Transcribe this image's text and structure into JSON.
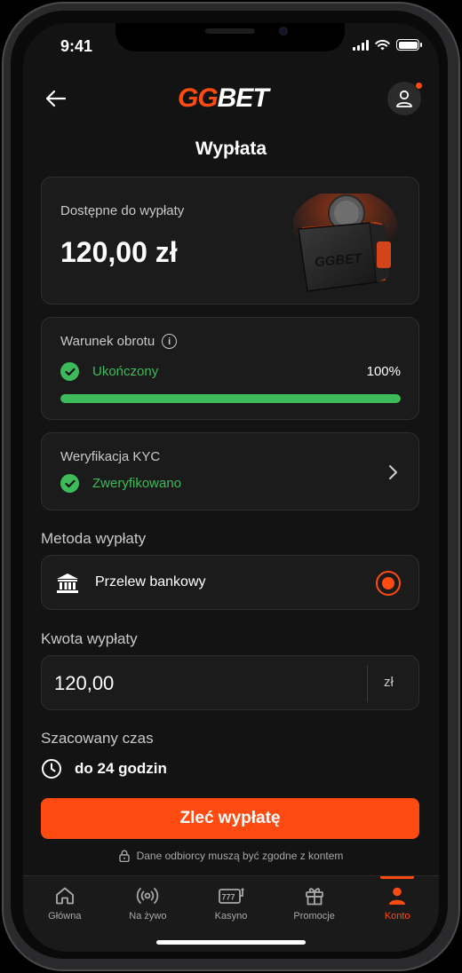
{
  "status_bar": {
    "time": "9:41"
  },
  "header": {
    "logo_gg": "GG",
    "logo_bet": "BET"
  },
  "page": {
    "title": "Wypłata"
  },
  "balance": {
    "label": "Dostępne do wypłaty",
    "value": "120,00 zł"
  },
  "turnover": {
    "label": "Warunek obrotu",
    "status": "Ukończony",
    "percent": "100%",
    "progress": 1.0
  },
  "kyc": {
    "label": "Weryfikacja KYC",
    "status": "Zweryfikowano"
  },
  "method": {
    "section_label": "Metoda wypłaty",
    "name": "Przelew bankowy",
    "selected": true
  },
  "amount": {
    "section_label": "Kwota wypłaty",
    "value": "120,00",
    "currency": "zł"
  },
  "estimated_time": {
    "section_label": "Szacowany czas",
    "value": "do 24 godzin"
  },
  "cta": {
    "label": "Zleć wypłatę"
  },
  "disclaimer": {
    "text": "Dane odbiorcy muszą być zgodne z kontem"
  },
  "tabbar": {
    "items": [
      {
        "label": "Główna",
        "icon": "home-icon"
      },
      {
        "label": "Na żywo",
        "icon": "live-icon"
      },
      {
        "label": "Kasyno",
        "icon": "slot-machine-icon"
      },
      {
        "label": "Promocje",
        "icon": "gift-icon"
      },
      {
        "label": "Konto",
        "icon": "account-icon"
      }
    ],
    "active": "Konto"
  },
  "colors": {
    "accent": "#ff4a12",
    "success": "#3dbb5a",
    "background": "#131313",
    "card": "#1b1b1b"
  }
}
